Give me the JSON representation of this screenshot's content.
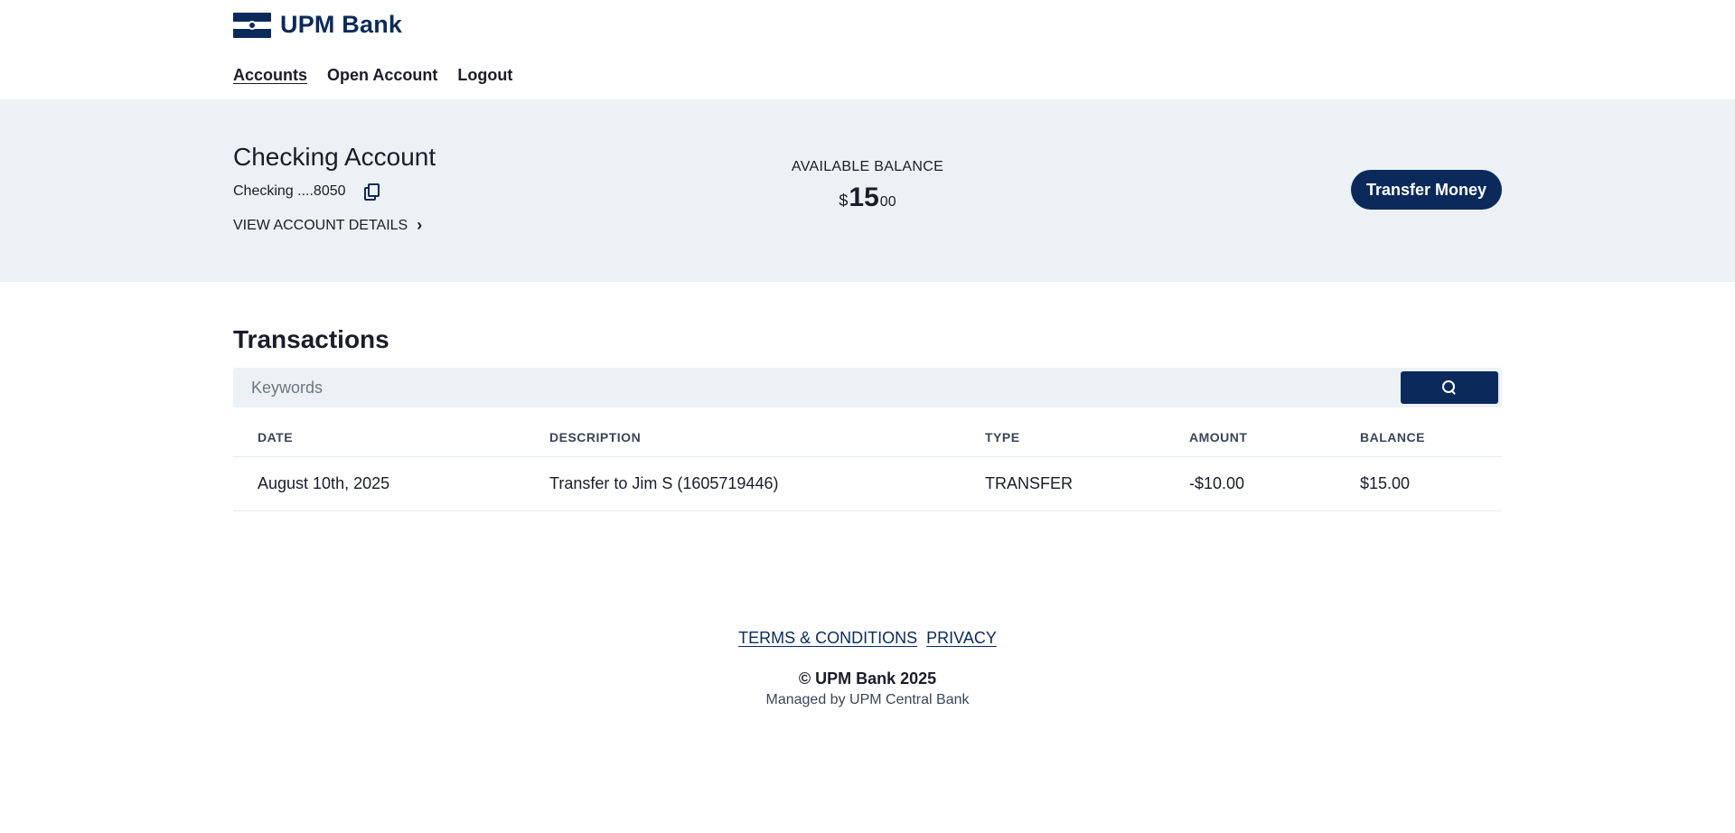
{
  "brand": {
    "name": "UPM Bank"
  },
  "nav": [
    {
      "label": "Accounts",
      "active": true
    },
    {
      "label": "Open Account",
      "active": false
    },
    {
      "label": "Logout",
      "active": false
    }
  ],
  "account": {
    "title": "Checking Account",
    "number_label": "Checking ....8050",
    "details_link": "VIEW ACCOUNT DETAILS",
    "balance_label": "AVAILABLE BALANCE",
    "balance_currency": "$",
    "balance_whole": "15",
    "balance_cents": "00",
    "transfer_button": "Transfer Money"
  },
  "transactions": {
    "title": "Transactions",
    "search_placeholder": "Keywords",
    "columns": [
      "DATE",
      "DESCRIPTION",
      "TYPE",
      "AMOUNT",
      "BALANCE"
    ],
    "rows": [
      {
        "date": "August 10th, 2025",
        "description": "Transfer to Jim S (1605719446)",
        "type": "TRANSFER",
        "amount": "-$10.00",
        "balance": "$15.00"
      }
    ]
  },
  "footer": {
    "links": [
      "TERMS & CONDITIONS",
      "PRIVACY"
    ],
    "copyright": "© UPM Bank 2025",
    "managed_by": "Managed by UPM Central Bank"
  },
  "colors": {
    "brand": "#0b2a5b",
    "band": "#ecf1f5"
  }
}
